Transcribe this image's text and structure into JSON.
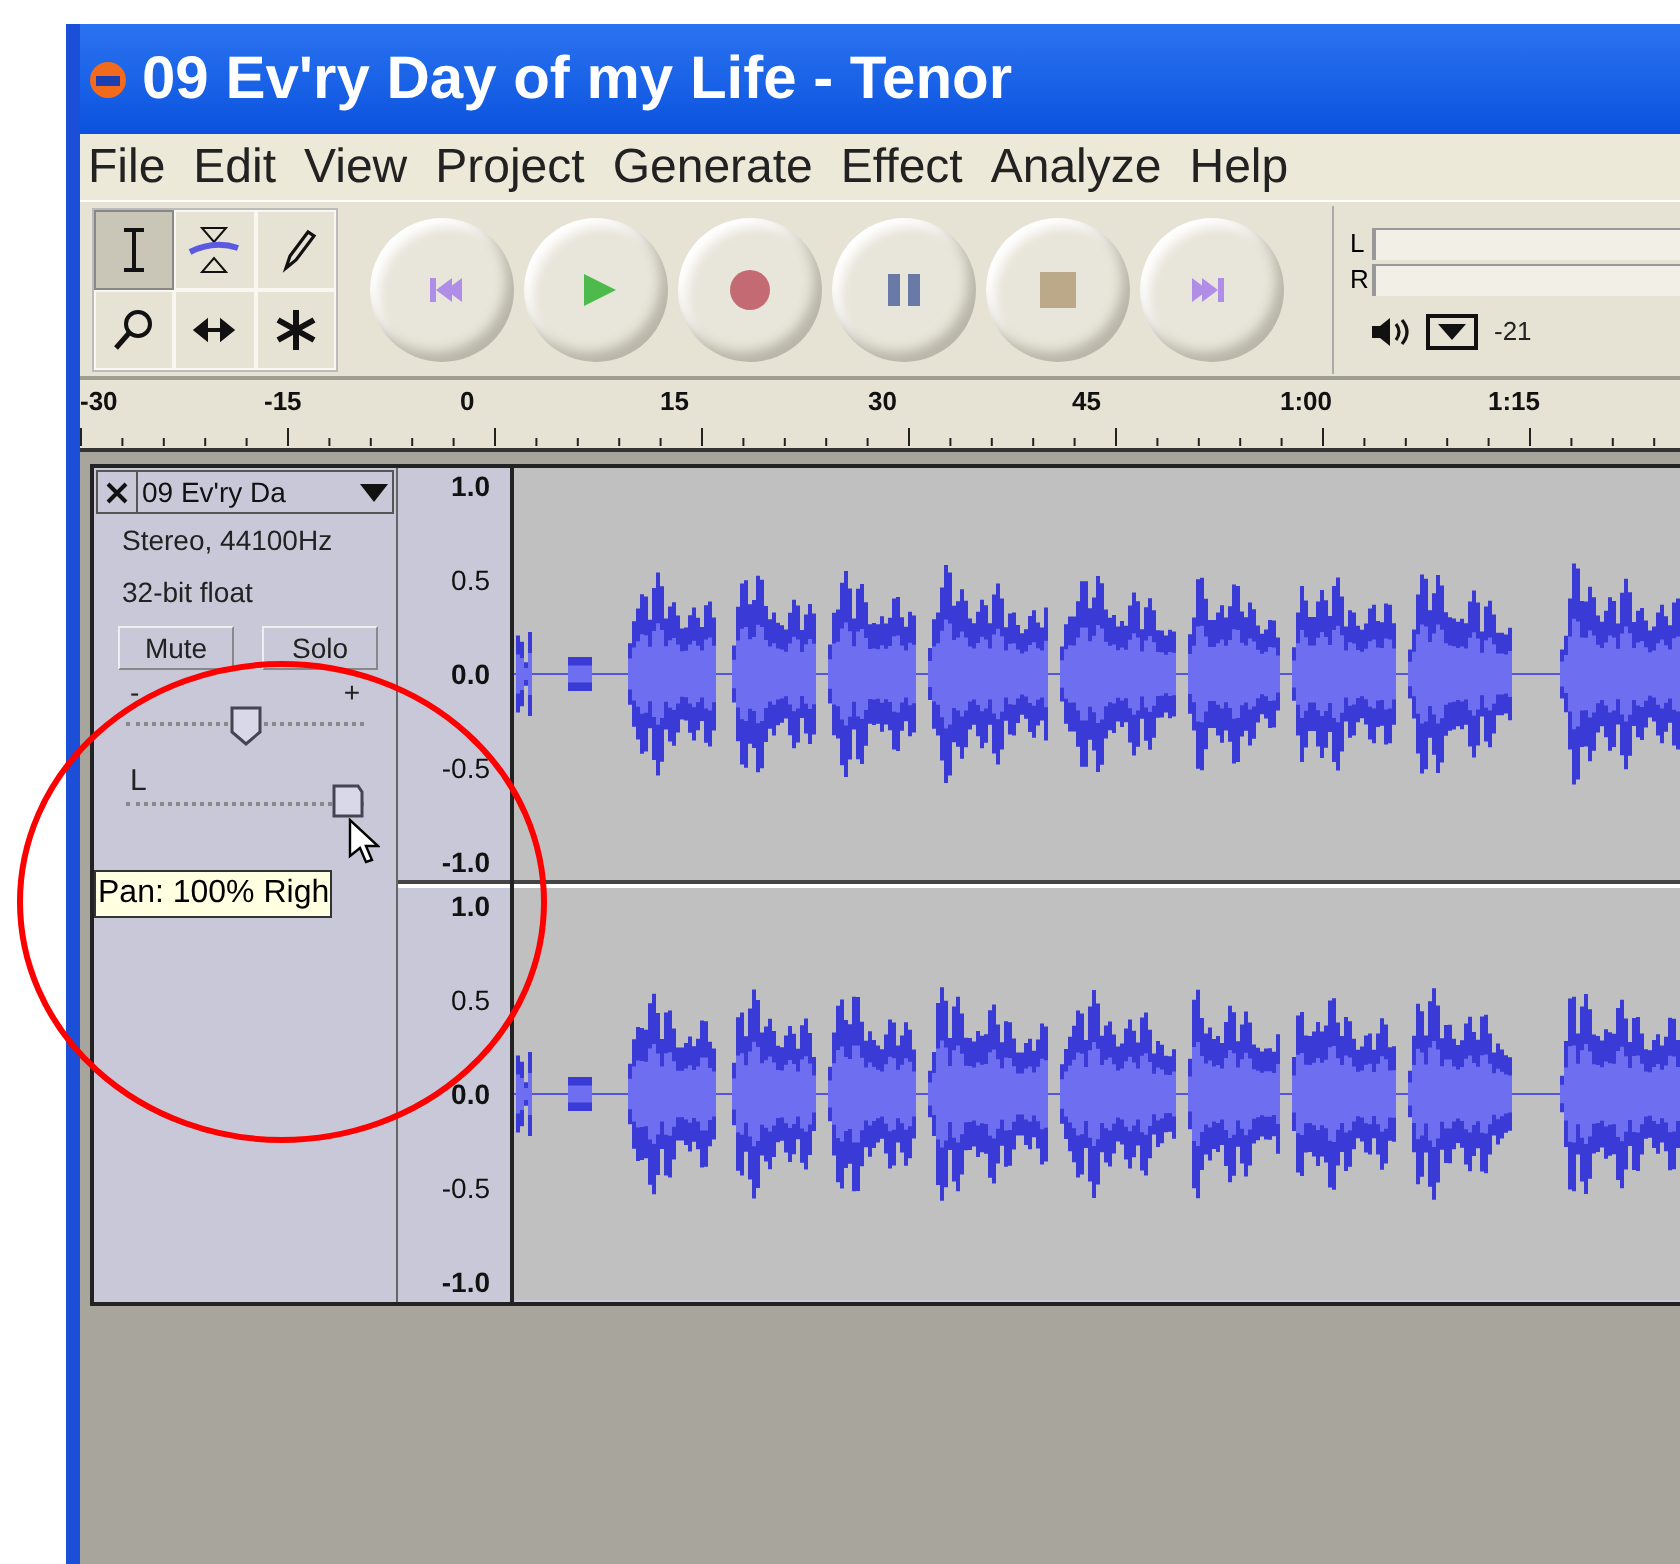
{
  "window": {
    "title": "09 Ev'ry Day of my Life - Tenor"
  },
  "menu": [
    "File",
    "Edit",
    "View",
    "Project",
    "Generate",
    "Effect",
    "Analyze",
    "Help"
  ],
  "tools": [
    {
      "kind": "select",
      "selected": true
    },
    {
      "kind": "envelope",
      "selected": false
    },
    {
      "kind": "draw",
      "selected": false
    },
    {
      "kind": "zoom",
      "selected": false
    },
    {
      "kind": "timeshift",
      "selected": false
    },
    {
      "kind": "multi",
      "selected": false
    }
  ],
  "transport": [
    {
      "kind": "skip_start"
    },
    {
      "kind": "play"
    },
    {
      "kind": "record"
    },
    {
      "kind": "pause"
    },
    {
      "kind": "stop"
    },
    {
      "kind": "skip_end"
    }
  ],
  "meter": {
    "left_label": "L",
    "right_label": "R",
    "scale": "-21"
  },
  "ruler": [
    "-30",
    "-15",
    "0",
    "15",
    "30",
    "45",
    "1:00",
    "1:15"
  ],
  "track": {
    "name": "09 Ev'ry Da",
    "info": [
      "Stereo, 44100Hz",
      "32-bit float"
    ],
    "mute": "Mute",
    "solo": "Solo",
    "gain": {
      "minus": "-",
      "plus": "+",
      "level": 0.5
    },
    "pan": {
      "left": "L",
      "level": 1
    },
    "tooltip": "Pan: 100% Righ",
    "channels": [
      {
        "scale": [
          "1.0",
          "0.5",
          "0.0",
          "-0.5",
          "-1.0"
        ]
      },
      {
        "scale": [
          "1.0",
          "0.5",
          "0.0",
          "-0.5",
          "-1.0"
        ]
      }
    ]
  }
}
